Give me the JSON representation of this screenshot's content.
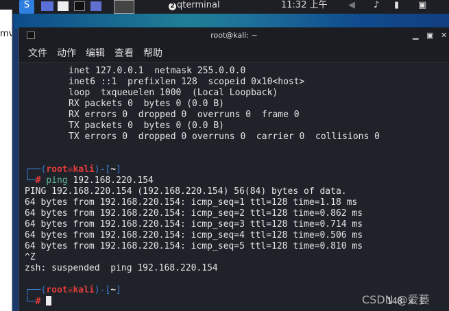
{
  "taskbar": {
    "window_count": "2",
    "window_label": "qterminal",
    "clock": "11:32 上午"
  },
  "left_panel": {
    "text": "mv"
  },
  "window": {
    "title": "root@kali: ~",
    "menu": [
      "文件",
      "动作",
      "编辑",
      "查看",
      "帮助"
    ]
  },
  "terminal": {
    "output_top": [
      "inet 127.0.0.1  netmask 255.0.0.0",
      "inet6 ::1  prefixlen 128  scopeid 0x10<host>",
      "loop  txqueuelen 1000  (Local Loopback)",
      "RX packets 0  bytes 0 (0.0 B)",
      "RX errors 0  dropped 0  overruns 0  frame 0",
      "TX packets 0  bytes 0 (0.0 B)",
      "TX errors 0  dropped 0 overruns 0  carrier 0  collisions 0"
    ],
    "prompt": {
      "user": "root",
      "host": "kali",
      "dir": "~",
      "symbol": "#"
    },
    "command": "ping",
    "command_args": " 192.168.220.154",
    "output": [
      "PING 192.168.220.154 (192.168.220.154) 56(84) bytes of data.",
      "64 bytes from 192.168.220.154: icmp_seq=1 ttl=128 time=1.18 ms",
      "64 bytes from 192.168.220.154: icmp_seq=2 ttl=128 time=0.862 ms",
      "64 bytes from 192.168.220.154: icmp_seq=3 ttl=128 time=0.714 ms",
      "64 bytes from 192.168.220.154: icmp_seq=4 ttl=128 time=0.506 ms",
      "64 bytes from 192.168.220.154: icmp_seq=5 ttl=128 time=0.810 ms",
      "^Z",
      "zsh: suspended  ping 192.168.220.154"
    ],
    "status_right": "148 ✕ 1"
  },
  "watermark": "CSDN @爱蒌"
}
